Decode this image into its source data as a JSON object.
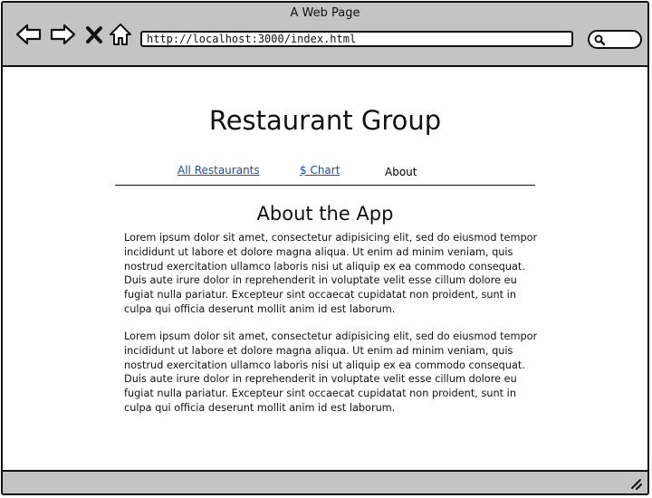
{
  "browser": {
    "window_title": "A Web Page",
    "url": "http://localhost:3000/index.html",
    "icons": {
      "back": "back-arrow-icon",
      "forward": "forward-arrow-icon",
      "stop": "close-icon",
      "home": "home-icon",
      "search": "search-icon",
      "resize": "resize-grip-icon"
    },
    "chrome_color": "#c4c4c4"
  },
  "page": {
    "title": "Restaurant Group",
    "nav": {
      "all_restaurants": "All Restaurants",
      "chart": "$ Chart",
      "about": "About"
    },
    "link_color": "#1f4f8f",
    "section_title": "About the App",
    "paragraphs": [
      "Lorem ipsum dolor sit amet, consectetur adipisicing elit, sed do eiusmod tempor incididunt ut labore et dolore magna aliqua. Ut enim ad minim veniam, quis nostrud exercitation ullamco laboris nisi ut aliquip ex ea commodo consequat. Duis aute irure dolor in reprehenderit in voluptate velit esse cillum dolore eu fugiat nulla pariatur. Excepteur sint occaecat cupidatat non proident, sunt in culpa qui officia deserunt mollit anim id est laborum.",
      "Lorem ipsum dolor sit amet, consectetur adipisicing elit, sed do eiusmod tempor incididunt ut labore et dolore magna aliqua. Ut enim ad minim veniam, quis nostrud exercitation ullamco laboris nisi ut aliquip ex ea commodo consequat. Duis aute irure dolor in reprehenderit in voluptate velit esse cillum dolore eu fugiat nulla pariatur. Excepteur sint occaecat cupidatat non proident, sunt in culpa qui officia deserunt mollit anim id est laborum."
    ]
  }
}
